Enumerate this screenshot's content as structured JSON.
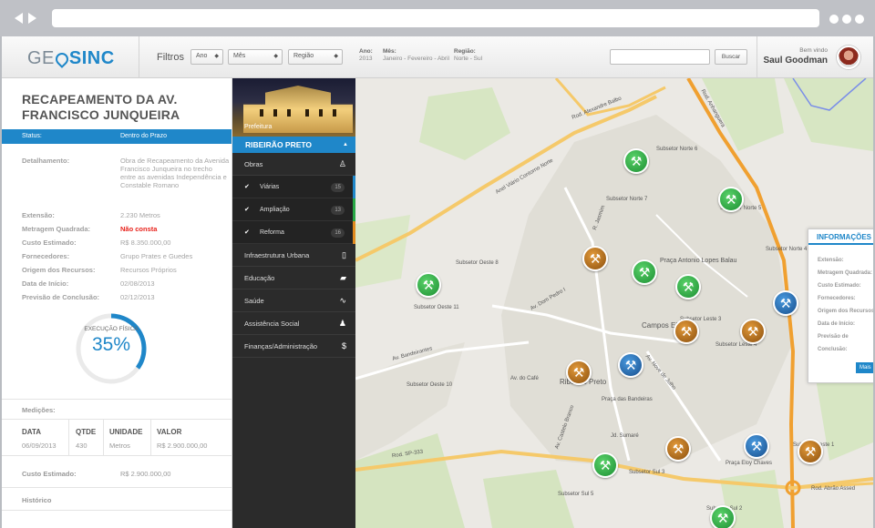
{
  "brand": {
    "geo": "GE",
    "sinc": "SINC"
  },
  "filters": {
    "label": "Filtros",
    "ano": "Ano",
    "mes": "Mês",
    "regiao": "Região",
    "info": [
      {
        "k": "Ano:",
        "v": "2013"
      },
      {
        "k": "Mês:",
        "v": "Janeiro - Fevereiro - Abril"
      },
      {
        "k": "Região:",
        "v": "Norte - Sul"
      }
    ]
  },
  "search": {
    "button": "Buscar"
  },
  "user": {
    "welcome": "Bem vindo",
    "name": "Saul Goodman"
  },
  "detail": {
    "title": "RECAPEAMENTO DA AV. FRANCISCO JUNQUEIRA",
    "status_label": "Status:",
    "status_value": "Dentro do Prazo",
    "fields": [
      {
        "k": "Detalhamento:",
        "v": "Obra de Recapeamento da Avenida Francisco Junqueira no trecho entre as avenidas Independência e Constable Romano"
      },
      {
        "k": "Extensão:",
        "v": "2.230 Metros"
      },
      {
        "k": "Metragem Quadrada:",
        "v": "Não consta"
      },
      {
        "k": "Custo Estimado:",
        "v": "R$ 8.350.000,00"
      },
      {
        "k": "Fornecedores:",
        "v": "Grupo Prates e Guedes"
      },
      {
        "k": "Origem dos Recursos:",
        "v": "Recursos Próprios"
      },
      {
        "k": "Data de Início:",
        "v": "02/08/2013"
      },
      {
        "k": "Previsão de Conclusão:",
        "v": "02/12/2013"
      }
    ],
    "execucao_label": "EXECUÇÃO FÍSICA",
    "execucao_pct": "35%",
    "execucao_fraction": 0.35,
    "medicoes_label": "Medições:",
    "table_headers": [
      "DATA",
      "QTDE",
      "UNIDADE",
      "VALOR"
    ],
    "table_row": [
      "06/09/2013",
      "430",
      "Metros",
      "R$ 2.900.000,00"
    ],
    "custo_label": "Custo Estimado:",
    "custo_value": "R$ 2.900.000,00",
    "historico_label": "Histórico"
  },
  "photo": {
    "label": "Prefeitura"
  },
  "menu": {
    "city": "RIBEIRÃO PRETO",
    "obras": "Obras",
    "subs": [
      {
        "label": "Viárias",
        "count": "15",
        "color": "#1f87c9"
      },
      {
        "label": "Ampliação",
        "count": "13",
        "color": "#28a745"
      },
      {
        "label": "Reforma",
        "count": "16",
        "color": "#e08a1e"
      }
    ],
    "items": [
      "Infraestrutura Urbana",
      "Educação",
      "Saúde",
      "Assistência Social",
      "Finanças/Administração"
    ]
  },
  "map": {
    "labels": [
      {
        "t": "Rod. Alexandre Balbo"
      },
      {
        "t": "Rod. Anhanguera"
      },
      {
        "t": "Anel Viário Contorno Norte"
      },
      {
        "t": "Subsetor Norte 6"
      },
      {
        "t": "Subsetor Norte 7"
      },
      {
        "t": "Subsetor Norte 5"
      },
      {
        "t": "Subsetor Norte 4"
      },
      {
        "t": "Subsetor Oeste 11"
      },
      {
        "t": "R. Jasmim"
      },
      {
        "t": "Praça Antonio Lopes Balau"
      },
      {
        "t": "Campos Elíseos"
      },
      {
        "t": "Subsetor Leste 4"
      },
      {
        "t": "Subsetor Leste 3"
      },
      {
        "t": "Subsetor Oeste 8"
      },
      {
        "t": "Av. Bandeirantes"
      },
      {
        "t": "Av. Dom Pedro I"
      },
      {
        "t": "Ribeirão Preto"
      },
      {
        "t": "Praça das Bandeiras"
      },
      {
        "t": "Av. do Café"
      },
      {
        "t": "Subsetor Oeste 10"
      },
      {
        "t": "Jd. Sumaré"
      },
      {
        "t": "Subsetor Sul 3"
      },
      {
        "t": "Praça Eloy Chaves"
      },
      {
        "t": "Subsetor Leste 1"
      },
      {
        "t": "Subsetor Sul 2"
      },
      {
        "t": "Subsetor Sul 5"
      },
      {
        "t": "Rod. SP-333"
      },
      {
        "t": "Rod. Abrão Assed"
      },
      {
        "t": "Av. Castelo Branco"
      },
      {
        "t": "Av. Nove de Julho"
      }
    ]
  },
  "info_panel": {
    "title": "INFORMAÇÕES",
    "fields": [
      "Extensão:",
      "Metragem Quadrada:",
      "Custo Estimado:",
      "Fornecedores:",
      "Origem dos Recursos:",
      "Data de Início:",
      "Previsão de Conclusão:"
    ],
    "more": "Mais"
  }
}
